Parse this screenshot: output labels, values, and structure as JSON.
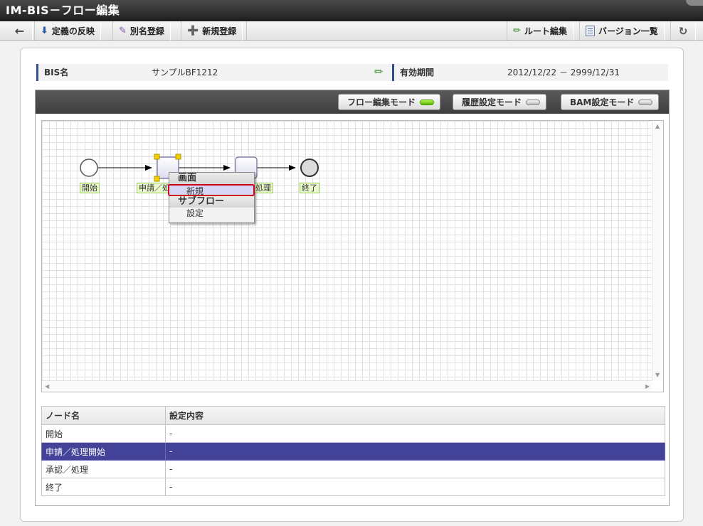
{
  "window": {
    "title": "IM-BIS－フロー編集"
  },
  "toolbar": {
    "back_icon": "back-arrow-icon",
    "apply_definition": "定義の反映",
    "alias_register": "別名登録",
    "new_register": "新規登録",
    "route_edit": "ルート編集",
    "version_list": "バージョン一覧",
    "refresh_icon": "refresh-icon"
  },
  "info": {
    "bis_name_label": "BIS名",
    "bis_name_value": "サンプルBF1212",
    "validity_label": "有効期間",
    "validity_value": "2012/12/22 － 2999/12/31"
  },
  "modes": {
    "flow_edit": "フロー編集モード",
    "flow_edit_active": true,
    "history": "履歴設定モード",
    "bam": "BAM設定モード"
  },
  "flow": {
    "nodes": [
      {
        "label": "開始",
        "kind": "start"
      },
      {
        "label": "申請／処理開始",
        "kind": "task"
      },
      {
        "label": "承認／処理",
        "kind": "task"
      },
      {
        "label": "終了",
        "kind": "end"
      }
    ],
    "visible_labels": {
      "start": "開始",
      "apply_partial": "申請／処",
      "approve_partial": "処理",
      "end": "終了"
    }
  },
  "context_menu": {
    "section1": "画面",
    "item_new": "新規",
    "section2": "サブフロー",
    "item_settings": "設定"
  },
  "table": {
    "headers": [
      "ノード名",
      "設定内容"
    ],
    "rows": [
      {
        "name": "開始",
        "value": "-",
        "selected": false
      },
      {
        "name": "申請／処理開始",
        "value": "-",
        "selected": true
      },
      {
        "name": "承認／処理",
        "value": "-",
        "selected": false
      },
      {
        "name": "終了",
        "value": "-",
        "selected": false
      }
    ]
  },
  "colors": {
    "selected_row": "#43439a",
    "highlight_border": "#d0021b",
    "label_bg": "#e9f8cd",
    "mode_on": "#55b800"
  }
}
